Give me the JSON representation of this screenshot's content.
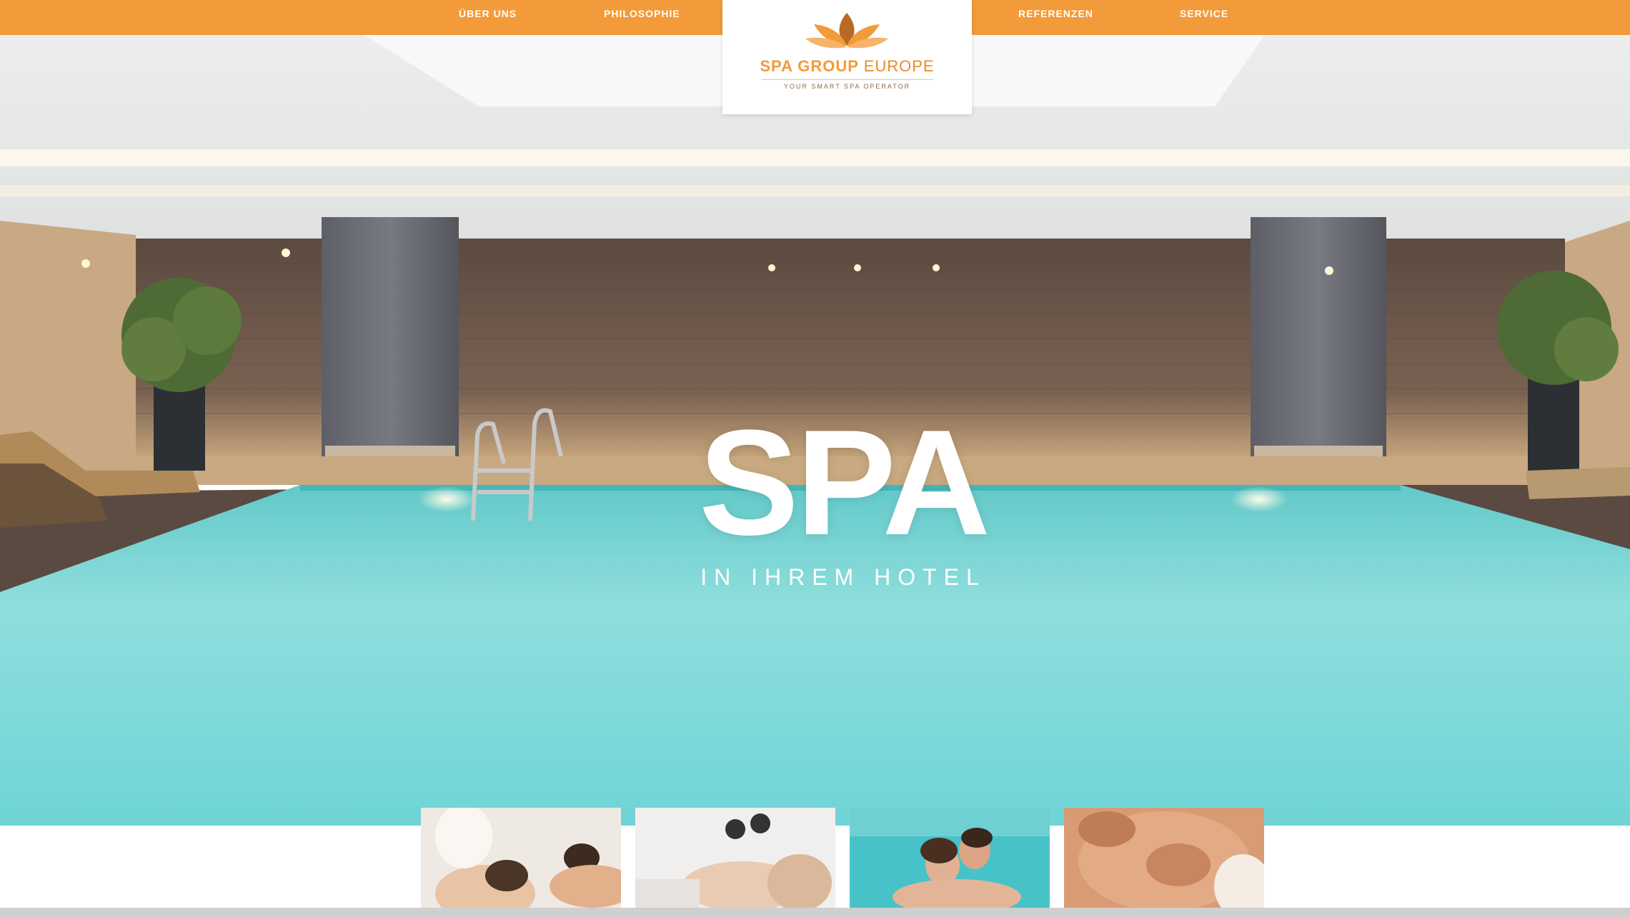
{
  "nav": {
    "items": [
      {
        "label": "ÜBER UNS"
      },
      {
        "label": "PHILOSOPHIE"
      },
      {
        "label": "REFERENZEN"
      },
      {
        "label": "SERVICE"
      }
    ]
  },
  "logo": {
    "brand_part1": "SPA GROUP",
    "brand_part2": "EUROPE",
    "tagline": "YOUR SMART SPA OPERATOR",
    "icon": "lotus-icon"
  },
  "hero": {
    "title": "SPA",
    "subtitle": "IN IHREM HOTEL"
  },
  "thumbnails": [
    {
      "icon": "massage-photo"
    },
    {
      "icon": "facial-treatment-photo"
    },
    {
      "icon": "couple-pool-photo"
    },
    {
      "icon": "face-massage-photo"
    }
  ],
  "colors": {
    "accent": "#f39a3a",
    "pool": "#6fd0d2",
    "wall": "#6b5548"
  }
}
